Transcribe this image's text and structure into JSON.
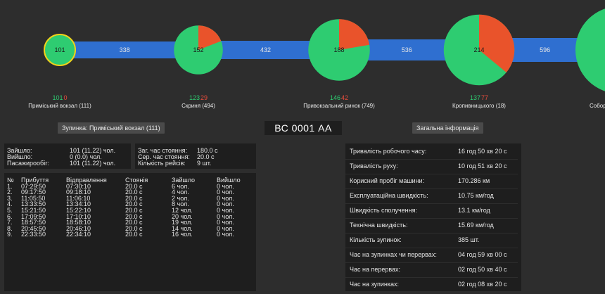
{
  "route": {
    "vehicle_plate": "ВС 0001 АА",
    "stops": [
      {
        "label": "Приміський вокзал (111)",
        "in": 101,
        "out": 0,
        "pax": 101
      },
      {
        "label": "Скриня (494)",
        "in": 123,
        "out": 29,
        "pax": 152
      },
      {
        "label": "Привокзальний ринок (749)",
        "in": 146,
        "out": 42,
        "pax": 188
      },
      {
        "label": "Кропивницького (18)",
        "in": 137,
        "out": 77,
        "pax": 214
      },
      {
        "label": "Собор",
        "in": null,
        "out": null,
        "pax": null
      }
    ],
    "segments": [
      {
        "load": "338"
      },
      {
        "load": "432"
      },
      {
        "load": "536"
      },
      {
        "load": "596"
      }
    ]
  },
  "stop_panel": {
    "header": "Зупинка: Приміський вокзал (111)",
    "summary": {
      "in_label": "Зайшло:",
      "in_value": "101 (11.22) чол.",
      "out_label": "Вийшло:",
      "out_value": "0 (0.0) чол.",
      "flow_label": "Пасажирообіг:",
      "flow_value": "101 (11.22) чол.",
      "total_dwell_label": "Заг. час стояння:",
      "total_dwell_value": "180.0 с",
      "avg_dwell_label": "Сер. час стояння:",
      "avg_dwell_value": "20.0 с",
      "trips_label": "Кількість рейсів:",
      "trips_value": "9 шт."
    },
    "columns": [
      "№",
      "Прибуття",
      "Відправлення",
      "Стоянія",
      "Зайшло",
      "Вийшло"
    ],
    "rows": [
      [
        "1.",
        "07:29:50",
        "07:30:10",
        "20.0 с",
        "6 чол.",
        "0 чол."
      ],
      [
        "2.",
        "09:17:50",
        "09:18:10",
        "20.0 с",
        "4 чол.",
        "0 чол."
      ],
      [
        "3.",
        "11:05:50",
        "11:06:10",
        "20.0 с",
        "2 чол.",
        "0 чол."
      ],
      [
        "4.",
        "13:33:50",
        "13:34:10",
        "20.0 с",
        "8 чол.",
        "0 чол."
      ],
      [
        "5.",
        "15:21:50",
        "15:22:10",
        "20.0 с",
        "12 чол.",
        "0 чол."
      ],
      [
        "6.",
        "17:09:50",
        "17:10:10",
        "20.0 с",
        "20 чол.",
        "0 чол."
      ],
      [
        "7.",
        "18:57:50",
        "18:58:10",
        "20.0 с",
        "19 чол.",
        "0 чол."
      ],
      [
        "8.",
        "20:45:50",
        "20:46:10",
        "20.0 с",
        "14 чол.",
        "0 чол."
      ],
      [
        "9.",
        "22:33:50",
        "22:34:10",
        "20.0 с",
        "16 чол.",
        "0 чол."
      ]
    ]
  },
  "info_panel": {
    "header": "Загальна інформація",
    "rows": [
      {
        "label": "Тривалість робочого часу:",
        "value": "16 год 50 хв 20 с"
      },
      {
        "label": "Тривалість руху:",
        "value": "10 год 51 хв 20 с"
      },
      {
        "label": "Корисний пробіг машини:",
        "value": "170.286 км"
      },
      {
        "label": "Експлуатаційна швидкість:",
        "value": "10.75 км/год"
      },
      {
        "label": "Швидкість сполучення:",
        "value": "13.1 км/год"
      },
      {
        "label": "Технічна швидкість:",
        "value": "15.69 км/год"
      },
      {
        "label": "Кількість зупинок:",
        "value": "385 шт."
      },
      {
        "label": "Час на зупинках чи перервах:",
        "value": "04 год 59 хв 00 с"
      },
      {
        "label": "Час на перервах:",
        "value": "02 год 50 хв 40 с"
      },
      {
        "label": "Час на зупинках:",
        "value": "02 год 08 хв 20 с"
      }
    ]
  },
  "colors": {
    "bar": "#2f6fd0",
    "in": "#2ecc71",
    "out": "#e9532b",
    "selected_ring": "#f1d21b",
    "background": "#2d2d2d",
    "panel": "#1e1e1e"
  }
}
